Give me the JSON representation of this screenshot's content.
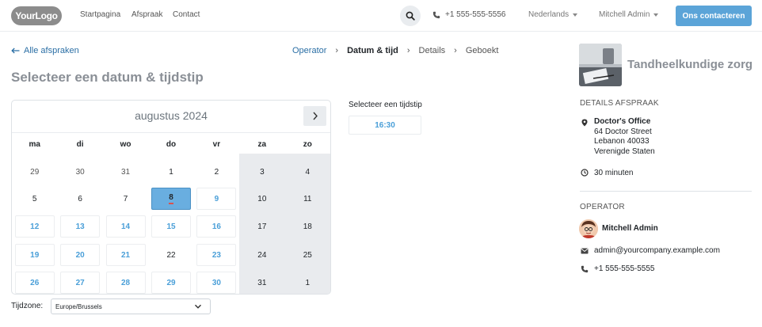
{
  "header": {
    "logo_text": "YourLogo",
    "nav": [
      "Startpagina",
      "Afspraak",
      "Contact"
    ],
    "phone": "+1 555-555-5556",
    "language": "Nederlands",
    "user": "Mitchell Admin",
    "cta": "Ons contacteren"
  },
  "breadcrumb": {
    "back": "Alle afspraken",
    "steps": [
      "Operator",
      "Datum & tijd",
      "Details",
      "Geboekt"
    ],
    "current_index": 1
  },
  "page_title": "Selecteer een datum & tijdstip",
  "calendar": {
    "month": "augustus 2024",
    "weekdays": [
      "ma",
      "di",
      "wo",
      "do",
      "vr",
      "za",
      "zo"
    ],
    "weeks": [
      [
        {
          "d": "29",
          "s": "muted"
        },
        {
          "d": "30",
          "s": "muted"
        },
        {
          "d": "31",
          "s": "muted"
        },
        {
          "d": "1",
          "s": "plain"
        },
        {
          "d": "2",
          "s": "plain"
        },
        {
          "d": "3",
          "s": "wknd"
        },
        {
          "d": "4",
          "s": "wknd"
        }
      ],
      [
        {
          "d": "5",
          "s": "plain"
        },
        {
          "d": "6",
          "s": "plain"
        },
        {
          "d": "7",
          "s": "plain"
        },
        {
          "d": "8",
          "s": "selected"
        },
        {
          "d": "9",
          "s": "avail"
        },
        {
          "d": "10",
          "s": "wknd"
        },
        {
          "d": "11",
          "s": "wknd"
        }
      ],
      [
        {
          "d": "12",
          "s": "avail"
        },
        {
          "d": "13",
          "s": "avail"
        },
        {
          "d": "14",
          "s": "avail"
        },
        {
          "d": "15",
          "s": "avail"
        },
        {
          "d": "16",
          "s": "avail"
        },
        {
          "d": "17",
          "s": "wknd"
        },
        {
          "d": "18",
          "s": "wknd"
        }
      ],
      [
        {
          "d": "19",
          "s": "avail"
        },
        {
          "d": "20",
          "s": "avail"
        },
        {
          "d": "21",
          "s": "avail"
        },
        {
          "d": "22",
          "s": "plain"
        },
        {
          "d": "23",
          "s": "avail"
        },
        {
          "d": "24",
          "s": "wknd"
        },
        {
          "d": "25",
          "s": "wknd"
        }
      ],
      [
        {
          "d": "26",
          "s": "avail"
        },
        {
          "d": "27",
          "s": "avail"
        },
        {
          "d": "28",
          "s": "avail"
        },
        {
          "d": "29",
          "s": "avail"
        },
        {
          "d": "30",
          "s": "avail"
        },
        {
          "d": "31",
          "s": "wknd"
        },
        {
          "d": "1",
          "s": "wknd"
        }
      ]
    ]
  },
  "timeslots": {
    "title": "Selecteer een tijdstip",
    "slots": [
      "16:30"
    ]
  },
  "timezone": {
    "label": "Tijdzone:",
    "value": "Europe/Brussels"
  },
  "details": {
    "service_name": "Tandheelkundige zorg",
    "section_label": "DETAILS AFSPRAAK",
    "location_name": "Doctor's Office",
    "address_lines": [
      "64 Doctor Street",
      "Lebanon 40033",
      "Verenigde Staten"
    ],
    "duration": "30 minuten"
  },
  "operator": {
    "section_label": "OPERATOR",
    "name": "Mitchell Admin",
    "email": "admin@yourcompany.example.com",
    "phone": "+1 555-555-5555"
  },
  "colors": {
    "accent": "#5ba4d8",
    "link": "#2b6fa5",
    "available_day": "#4a9fd8",
    "selected_day": "#69aee0",
    "weekend_bg": "#e9ebee"
  }
}
